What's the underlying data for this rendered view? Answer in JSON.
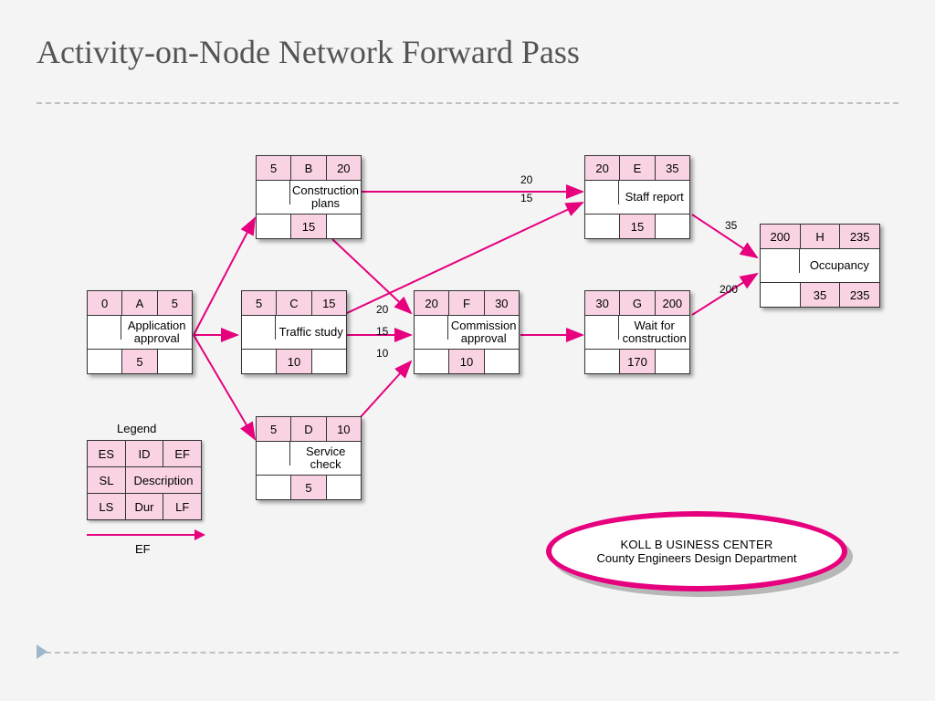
{
  "title": "Activity-on-Node Network Forward Pass",
  "chart_data": {
    "type": "network",
    "legend_labels": {
      "es": "ES",
      "id": "ID",
      "ef": "EF",
      "sl": "SL",
      "desc": "Description",
      "ls": "LS",
      "dur": "Dur",
      "lf": "LF",
      "ef_arrow": "EF"
    },
    "nodes": [
      {
        "id": "A",
        "description": "Application approval",
        "es": 0,
        "ef": 5,
        "dur": 5
      },
      {
        "id": "B",
        "description": "Construction plans",
        "es": 5,
        "ef": 20,
        "dur": 15
      },
      {
        "id": "C",
        "description": "Traffic study",
        "es": 5,
        "ef": 15,
        "dur": 10
      },
      {
        "id": "D",
        "description": "Service check",
        "es": 5,
        "ef": 10,
        "dur": 5
      },
      {
        "id": "E",
        "description": "Staff report",
        "es": 20,
        "ef": 35,
        "dur": 15
      },
      {
        "id": "F",
        "description": "Commission approval",
        "es": 20,
        "ef": 30,
        "dur": 10
      },
      {
        "id": "G",
        "description": "Wait for construction",
        "es": 30,
        "ef": 200,
        "dur": 170
      },
      {
        "id": "H",
        "description": "Occupancy",
        "es": 200,
        "ef": 235,
        "dur": 35,
        "ls": 235
      }
    ],
    "edges": [
      {
        "from": "A",
        "to": "B"
      },
      {
        "from": "A",
        "to": "C"
      },
      {
        "from": "A",
        "to": "D"
      },
      {
        "from": "B",
        "to": "E",
        "label": 20
      },
      {
        "from": "C",
        "to": "E",
        "label": 15
      },
      {
        "from": "B",
        "to": "F",
        "label": 20
      },
      {
        "from": "C",
        "to": "F",
        "label": 15
      },
      {
        "from": "D",
        "to": "F",
        "label": 10
      },
      {
        "from": "F",
        "to": "G"
      },
      {
        "from": "E",
        "to": "H",
        "label": 35
      },
      {
        "from": "G",
        "to": "H",
        "label": 200
      }
    ]
  },
  "legend_title": "Legend",
  "badge": {
    "line1": "KOLL B USINESS CENTER",
    "line2": "County Engineers Design Department"
  }
}
